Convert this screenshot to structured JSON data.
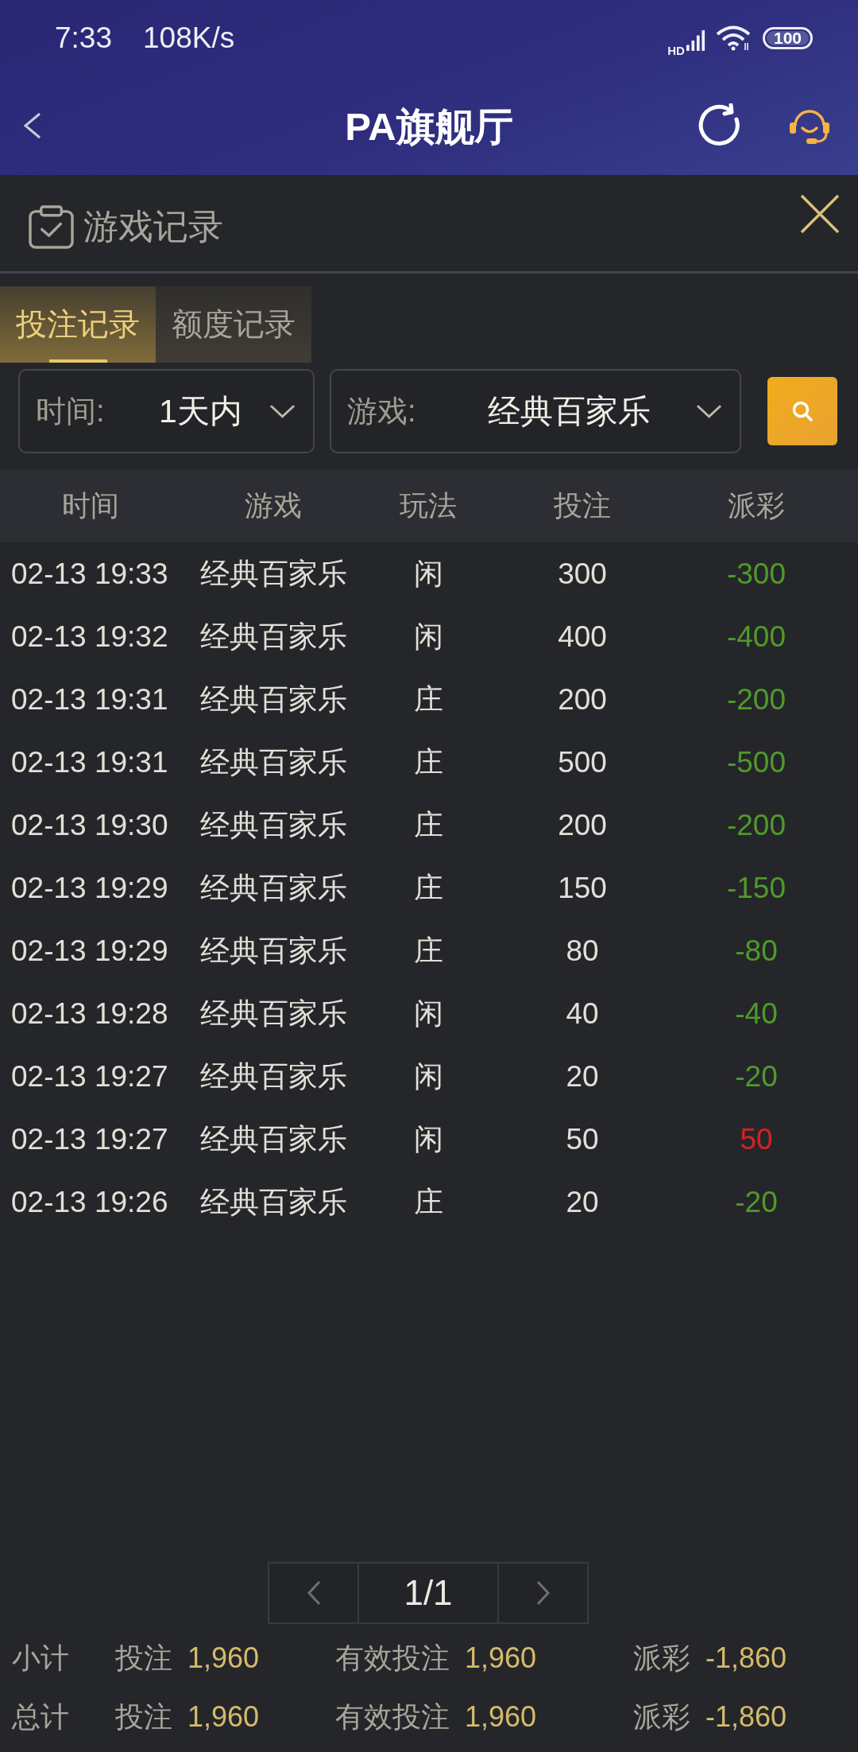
{
  "status_bar": {
    "time": "7:33",
    "speed": "108K/s",
    "network_type": "HD",
    "battery": "100"
  },
  "header": {
    "title": "PA旗舰厅"
  },
  "panel": {
    "title": "游戏记录"
  },
  "tabs": [
    {
      "label": "投注记录",
      "selected": true
    },
    {
      "label": "额度记录",
      "selected": false
    }
  ],
  "filters": [
    {
      "label": "时间:",
      "value": "1天内"
    },
    {
      "label": "游戏:",
      "value": "经典百家乐"
    }
  ],
  "table": {
    "columns": [
      "时间",
      "游戏",
      "玩法",
      "投注",
      "派彩"
    ],
    "rows": [
      {
        "time": "02-13 19:33",
        "game": "经典百家乐",
        "play": "闲",
        "bet": "300",
        "payout": "-300",
        "color": "#4f9a2a"
      },
      {
        "time": "02-13 19:32",
        "game": "经典百家乐",
        "play": "闲",
        "bet": "400",
        "payout": "-400",
        "color": "#4f9a2a"
      },
      {
        "time": "02-13 19:31",
        "game": "经典百家乐",
        "play": "庄",
        "bet": "200",
        "payout": "-200",
        "color": "#4f9a2a"
      },
      {
        "time": "02-13 19:31",
        "game": "经典百家乐",
        "play": "庄",
        "bet": "500",
        "payout": "-500",
        "color": "#4f9a2a"
      },
      {
        "time": "02-13 19:30",
        "game": "经典百家乐",
        "play": "庄",
        "bet": "200",
        "payout": "-200",
        "color": "#4f9a2a"
      },
      {
        "time": "02-13 19:29",
        "game": "经典百家乐",
        "play": "庄",
        "bet": "150",
        "payout": "-150",
        "color": "#4f9a2a"
      },
      {
        "time": "02-13 19:29",
        "game": "经典百家乐",
        "play": "庄",
        "bet": "80",
        "payout": "-80",
        "color": "#4f9a2a"
      },
      {
        "time": "02-13 19:28",
        "game": "经典百家乐",
        "play": "闲",
        "bet": "40",
        "payout": "-40",
        "color": "#4f9a2a"
      },
      {
        "time": "02-13 19:27",
        "game": "经典百家乐",
        "play": "闲",
        "bet": "20",
        "payout": "-20",
        "color": "#4f9a2a"
      },
      {
        "time": "02-13 19:27",
        "game": "经典百家乐",
        "play": "闲",
        "bet": "50",
        "payout": "50",
        "color": "#d42222"
      },
      {
        "time": "02-13 19:26",
        "game": "经典百家乐",
        "play": "庄",
        "bet": "20",
        "payout": "-20",
        "color": "#4f9a2a"
      }
    ]
  },
  "pagination": {
    "page": "1/1"
  },
  "summary": [
    {
      "label": "小计",
      "items": [
        {
          "label": "投注",
          "value": "1,960"
        },
        {
          "label": "有效投注",
          "value": "1,960"
        },
        {
          "label": "派彩",
          "value": "-1,860"
        }
      ]
    },
    {
      "label": "总计",
      "items": [
        {
          "label": "投注",
          "value": "1,960"
        },
        {
          "label": "有效投注",
          "value": "1,960"
        },
        {
          "label": "派彩",
          "value": "-1,860"
        }
      ]
    }
  ]
}
